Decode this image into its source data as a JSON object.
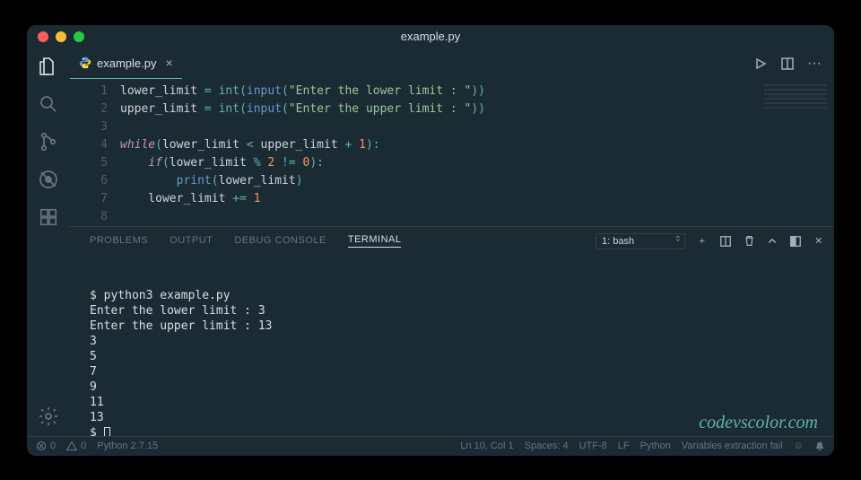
{
  "window": {
    "title": "example.py"
  },
  "tab": {
    "filename": "example.py"
  },
  "editor": {
    "lines": [
      {
        "n": 1,
        "tokens": [
          [
            "id",
            "lower_limit "
          ],
          [
            "op",
            "= "
          ],
          [
            "fn",
            "int"
          ],
          [
            "op",
            "("
          ],
          [
            "fn2",
            "input"
          ],
          [
            "op",
            "("
          ],
          [
            "str",
            "\"Enter the lower limit : \""
          ],
          [
            "op",
            "))"
          ]
        ]
      },
      {
        "n": 2,
        "tokens": [
          [
            "id",
            "upper_limit "
          ],
          [
            "op",
            "= "
          ],
          [
            "fn",
            "int"
          ],
          [
            "op",
            "("
          ],
          [
            "fn2",
            "input"
          ],
          [
            "op",
            "("
          ],
          [
            "str",
            "\"Enter the upper limit : \""
          ],
          [
            "op",
            "))"
          ]
        ]
      },
      {
        "n": 3,
        "tokens": []
      },
      {
        "n": 4,
        "tokens": [
          [
            "kw",
            "while"
          ],
          [
            "op",
            "("
          ],
          [
            "id",
            "lower_limit "
          ],
          [
            "op",
            "< "
          ],
          [
            "id",
            "upper_limit "
          ],
          [
            "op",
            "+ "
          ],
          [
            "num",
            "1"
          ],
          [
            "op",
            "):"
          ]
        ]
      },
      {
        "n": 5,
        "tokens": [
          [
            "id",
            "    "
          ],
          [
            "kw",
            "if"
          ],
          [
            "op",
            "("
          ],
          [
            "id",
            "lower_limit "
          ],
          [
            "op",
            "% "
          ],
          [
            "num",
            "2"
          ],
          [
            "op",
            " != "
          ],
          [
            "num",
            "0"
          ],
          [
            "op",
            "):"
          ]
        ]
      },
      {
        "n": 6,
        "tokens": [
          [
            "id",
            "        "
          ],
          [
            "fn2",
            "print"
          ],
          [
            "op",
            "("
          ],
          [
            "id",
            "lower_limit"
          ],
          [
            "op",
            ")"
          ]
        ]
      },
      {
        "n": 7,
        "tokens": [
          [
            "id",
            "    lower_limit "
          ],
          [
            "op",
            "+= "
          ],
          [
            "num",
            "1"
          ]
        ]
      },
      {
        "n": 8,
        "tokens": []
      }
    ]
  },
  "panel": {
    "tabs": {
      "problems": "PROBLEMS",
      "output": "OUTPUT",
      "debug": "DEBUG CONSOLE",
      "terminal": "TERMINAL"
    },
    "terminal_selector": "1: bash",
    "lines": [
      "$ python3 example.py",
      "Enter the lower limit : 3",
      "Enter the upper limit : 13",
      "3",
      "5",
      "7",
      "9",
      "11",
      "13",
      "$ "
    ]
  },
  "status": {
    "errors": "0",
    "warnings": "0",
    "python": "Python 2.7.15",
    "pos": "Ln 10, Col 1",
    "spaces": "Spaces: 4",
    "encoding": "UTF-8",
    "eol": "LF",
    "lang": "Python",
    "extra": "Variables extraction fail"
  },
  "watermark": "codevscolor.com"
}
